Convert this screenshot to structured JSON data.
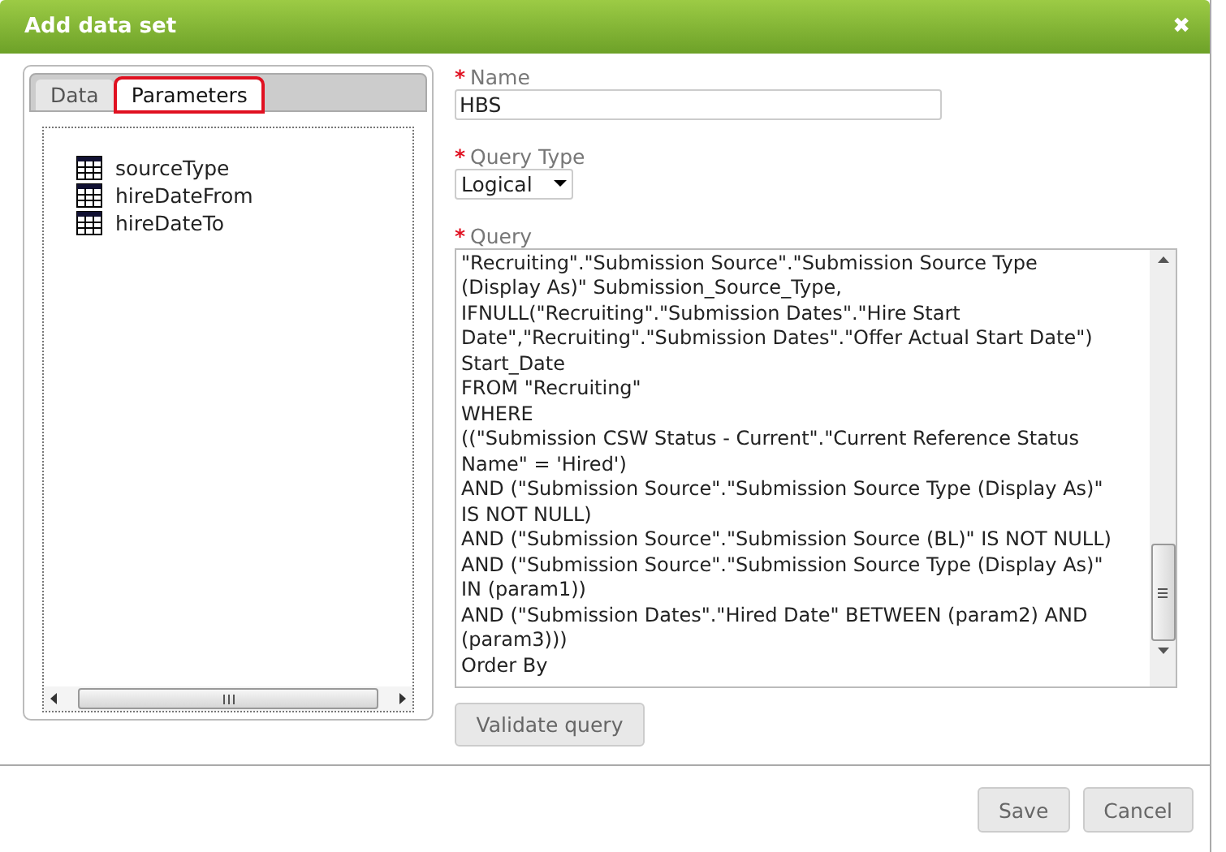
{
  "window": {
    "title": "Add data set",
    "close": "✖"
  },
  "tabs": [
    {
      "label": "Data",
      "selected": false
    },
    {
      "label": "Parameters",
      "selected": true
    }
  ],
  "parameters": [
    {
      "label": "sourceType"
    },
    {
      "label": "hireDateFrom"
    },
    {
      "label": "hireDateTo"
    }
  ],
  "form": {
    "name": {
      "label": "Name",
      "required_mark": "*",
      "value": "HBS"
    },
    "query_type": {
      "label": "Query Type",
      "required_mark": "*",
      "value": "Logical"
    },
    "query": {
      "label": "Query",
      "required_mark": "*",
      "lines": [
        "\"Recruiting\".\"Submission Source\".\"Submission Source Type",
        "(Display As)\" Submission_Source_Type,",
        "IFNULL(\"Recruiting\".\"Submission Dates\".\"Hire Start",
        "Date\",\"Recruiting\".\"Submission Dates\".\"Offer Actual Start Date\")",
        "Start_Date",
        "FROM \"Recruiting\"",
        "WHERE",
        "((\"Submission CSW Status - Current\".\"Current Reference Status",
        "Name\" = 'Hired')",
        "AND (\"Submission Source\".\"Submission Source Type (Display As)\"",
        "IS NOT NULL)",
        "AND (\"Submission Source\".\"Submission Source (BL)\" IS NOT NULL)",
        "AND (\"Submission Source\".\"Submission Source Type (Display As)\"",
        "IN (param1))",
        "AND (\"Submission Dates\".\"Hired Date\" BETWEEN (param2) AND",
        "(param3)))",
        "Order By"
      ]
    },
    "validate_button": "Validate query"
  },
  "buttons": [
    {
      "label": "Save"
    },
    {
      "label": "Cancel"
    }
  ]
}
